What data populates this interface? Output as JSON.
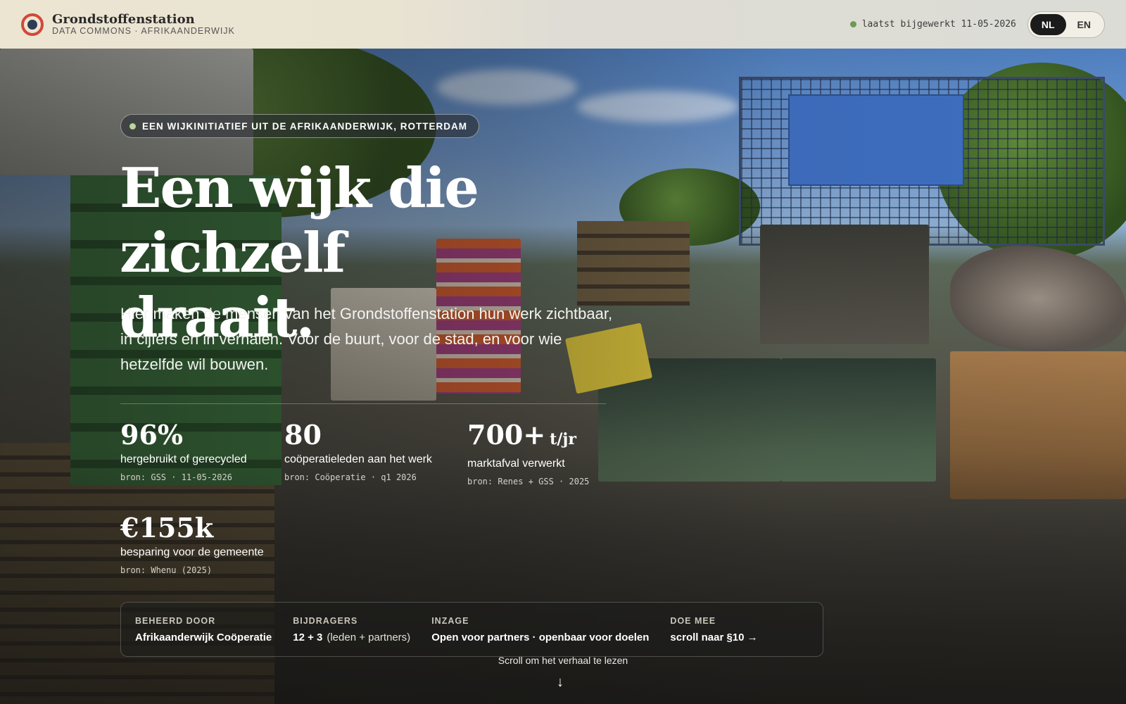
{
  "header": {
    "brand_title": "Grondstoffenstation",
    "brand_subtitle": "DATA COMMONS · AFRIKAANDERWIJK",
    "updated_text": "laatst bijgewerkt 11-05-2026",
    "lang_nl": "NL",
    "lang_en": "EN",
    "active_lang": "NL"
  },
  "hero": {
    "eyebrow": "EEN WIJKINITIATIEF UIT DE AFRIKAANDERWIJK, ROTTERDAM",
    "title_line1": "Een wijk die zichzelf",
    "title_line2": "draait.",
    "lead": "Hier maken de mensen van het Grondstoffenstation hun werk zichtbaar, in cijfers en in verhalen. Voor de buurt, voor de stad, en voor wie hetzelfde wil bouwen."
  },
  "stats": [
    {
      "value": "96%",
      "unit": "",
      "label": "hergebruikt of gerecycled",
      "source": "bron: GSS · 11-05-2026"
    },
    {
      "value": "80",
      "unit": "",
      "label": "coöperatieleden aan het werk",
      "source": "bron: Coöperatie · q1 2026"
    },
    {
      "value": "700+",
      "unit": "t/jr",
      "label": "marktafval verwerkt",
      "source": "bron: Renes + GSS · 2025"
    },
    {
      "value": "€155k",
      "unit": "",
      "label": "besparing voor de gemeente",
      "source": "bron: Whenu (2025)"
    }
  ],
  "info": [
    {
      "key": "BEHEERD DOOR",
      "value": "Afrikaanderwijk Coöperatie",
      "extra": ""
    },
    {
      "key": "BIJDRAGERS",
      "value": "12 + 3",
      "extra": "(leden + partners)"
    },
    {
      "key": "INZAGE",
      "value": "Open voor partners · openbaar voor doelen",
      "extra": ""
    },
    {
      "key": "DOE MEE",
      "value": "scroll naar §10 →",
      "extra": ""
    }
  ],
  "scroll_hint": "Scroll om het verhaal te lezen",
  "colors": {
    "accent_red": "#d2483a",
    "status_green": "#6d9a55",
    "dark": "#1b1b1b"
  }
}
